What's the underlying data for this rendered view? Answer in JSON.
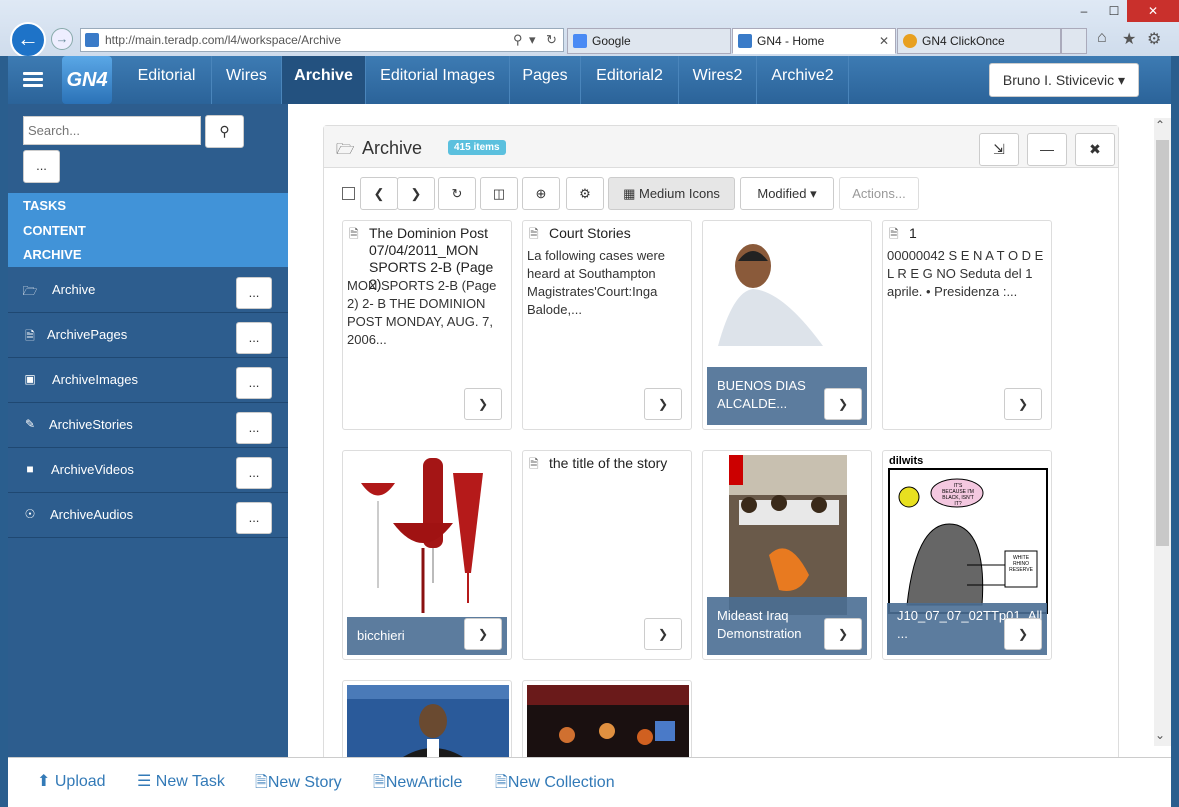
{
  "browser": {
    "url": "http://main.teradp.com/l4/workspace/Archive",
    "tabs": [
      {
        "label": "Google",
        "active": false
      },
      {
        "label": "GN4 - Home",
        "active": true
      },
      {
        "label": "GN4 ClickOnce",
        "active": false
      }
    ],
    "window_controls": [
      "–",
      "☐",
      "✕"
    ]
  },
  "app": {
    "logo": "GN4",
    "nav": [
      "Editorial",
      "Wires",
      "Archive",
      "Editorial Images",
      "Pages",
      "Editorial2",
      "Wires2",
      "Archive2"
    ],
    "active_nav": "Archive",
    "user": "Bruno I. Stivicevic"
  },
  "sidebar": {
    "search_placeholder": "Search...",
    "more_label": "...",
    "sections": [
      "TASKS",
      "CONTENT",
      "ARCHIVE"
    ],
    "items": [
      {
        "label": "Archive",
        "icon": "folder-open-icon"
      },
      {
        "label": "ArchivePages",
        "icon": "file-icon"
      },
      {
        "label": "ArchiveImages",
        "icon": "camera-icon"
      },
      {
        "label": "ArchiveStories",
        "icon": "pencil-icon"
      },
      {
        "label": "ArchiveVideos",
        "icon": "video-camera-icon"
      },
      {
        "label": "ArchiveAudios",
        "icon": "headphones-icon"
      }
    ]
  },
  "panel": {
    "title": "Archive",
    "badge": "415 items",
    "view_mode": "Medium Icons",
    "sort": "Modified",
    "actions": "Actions...",
    "cards": [
      {
        "title": "The Dominion Post 07/04/2011_MON SPORTS 2-B (Page 2)",
        "text": "MON SPORTS 2-B (Page 2) 2- B THE DOMINION POST MONDAY, AUG. 7, 2006...",
        "icon": "file-icon"
      },
      {
        "title": "Court Stories",
        "text": "La following cases were heard at Southampton Magistrates'Court:Inga Balode,...",
        "icon": "story-icon"
      },
      {
        "caption": "BUENOS DIAS ALCALDE...",
        "icon": "image"
      },
      {
        "title": "1",
        "text": "00000042 S E N A T O D E L R E G NO Seduta del 1 aprile. • Presidenza :...",
        "icon": "file-icon"
      },
      {
        "caption": "bicchieri",
        "icon": "image"
      },
      {
        "title": "the title of the story",
        "icon": "story-icon"
      },
      {
        "caption": "Mideast Iraq Demonstration",
        "icon": "image"
      },
      {
        "caption": "J10_07_07_02TTp01_All ...",
        "icon": "image"
      },
      {
        "icon": "image"
      },
      {
        "icon": "image"
      }
    ],
    "comic_text": {
      "brand": "dilwits",
      "bubble": "IT'S BECAUSE I'M BLACK, ISN'T IT?",
      "sign": "WHITE RHINO RESERVE"
    }
  },
  "bottom": {
    "links": [
      "Upload",
      "New Task",
      "New Story",
      "NewArticle",
      "New Collection"
    ]
  }
}
